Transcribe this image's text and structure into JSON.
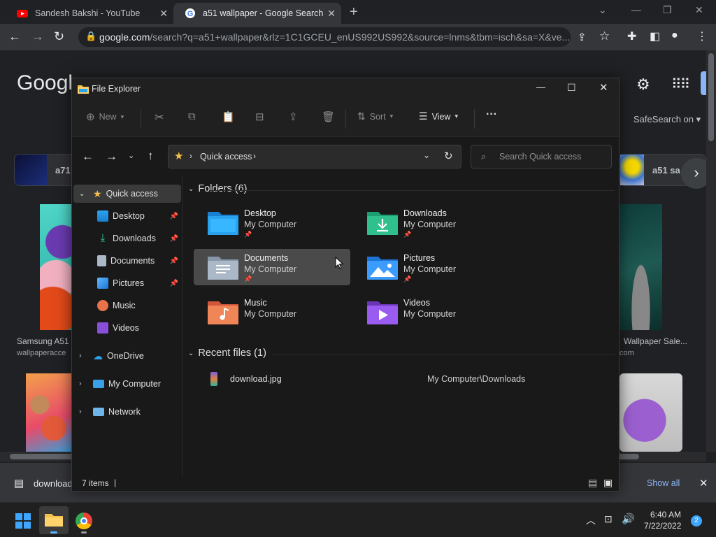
{
  "browser": {
    "tabs": [
      {
        "title": "Sandesh Bakshi - YouTube",
        "close": "✕"
      },
      {
        "title": "a51 wallpaper - Google Search",
        "close": "✕"
      }
    ],
    "new_tab": "+",
    "url_host": "google.com",
    "url_rest": "/search?q=a51+wallpaper&rlz=1C1GCEU_enUS992US992&source=lnms&tbm=isch&sa=X&ve..."
  },
  "google": {
    "logo": "Googl",
    "safesearch": "SafeSearch on",
    "chips": [
      {
        "label": "a71"
      },
      {
        "label": "a51 sa"
      }
    ],
    "results": [
      {
        "title": "Samsung A51",
        "source": "wallpaperacce"
      },
      {
        "title": "Wallpaper Sale...",
        "source": "com"
      }
    ]
  },
  "explorer": {
    "title": "File Explorer",
    "commands": {
      "new": "New",
      "sort": "Sort",
      "view": "View",
      "more": "···"
    },
    "address": {
      "location": "Quick access"
    },
    "search_placeholder": "Search Quick access",
    "nav": {
      "quick_access": "Quick access",
      "items": [
        {
          "label": "Desktop",
          "pinned": true
        },
        {
          "label": "Downloads",
          "pinned": true
        },
        {
          "label": "Documents",
          "pinned": true
        },
        {
          "label": "Pictures",
          "pinned": true
        },
        {
          "label": "Music",
          "pinned": false
        },
        {
          "label": "Videos",
          "pinned": false
        }
      ],
      "onedrive": "OneDrive",
      "my_computer": "My Computer",
      "network": "Network"
    },
    "folders_header": "Folders (6)",
    "folders": [
      {
        "name": "Desktop",
        "location": "My Computer",
        "pinned": true
      },
      {
        "name": "Downloads",
        "location": "My Computer",
        "pinned": true
      },
      {
        "name": "Documents",
        "location": "My Computer",
        "pinned": true
      },
      {
        "name": "Pictures",
        "location": "My Computer",
        "pinned": true
      },
      {
        "name": "Music",
        "location": "My Computer",
        "pinned": false
      },
      {
        "name": "Videos",
        "location": "My Computer",
        "pinned": false
      }
    ],
    "recent_header": "Recent files (1)",
    "recent": [
      {
        "name": "download.jpg",
        "path": "My Computer\\Downloads"
      }
    ],
    "status": "7 items"
  },
  "download_bar": {
    "file": "download",
    "show_all": "Show all"
  },
  "taskbar": {
    "time": "6:40 AM",
    "date": "7/22/2022",
    "notifications": "2"
  },
  "colors": {
    "accent": "#0078d4",
    "folder_yellow": "#f5c04a",
    "folder_blue": "#2aa3ef",
    "chrome_dark": "#202124"
  }
}
